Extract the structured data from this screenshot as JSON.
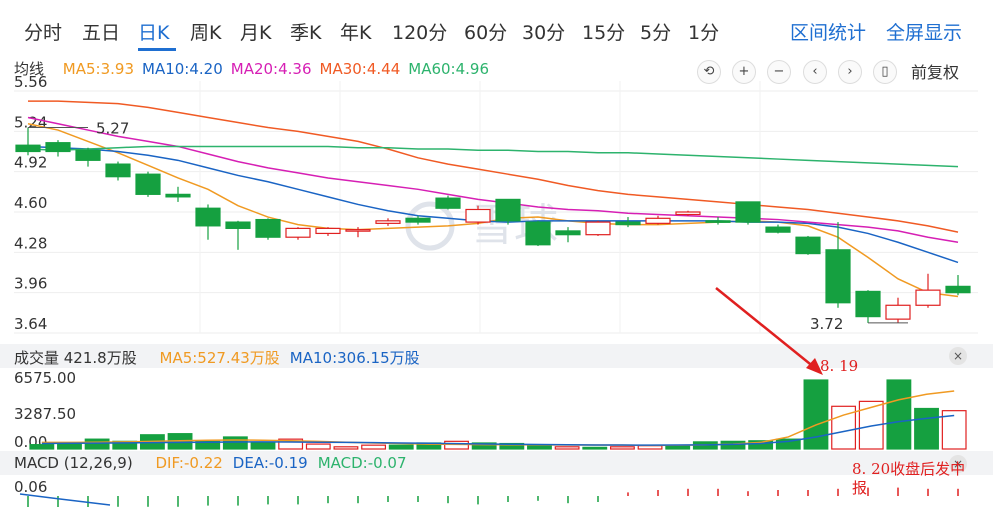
{
  "tabs": [
    "分时",
    "五日",
    "日K",
    "周K",
    "月K",
    "季K",
    "年K",
    "120分",
    "60分",
    "30分",
    "15分",
    "5分",
    "1分"
  ],
  "active_tab": "日K",
  "right_links": [
    "区间统计",
    "全屏显示"
  ],
  "ma_legend": {
    "label": "均线",
    "items": [
      {
        "text": "MA5:3.93",
        "color": "#f09a22"
      },
      {
        "text": "MA10:4.20",
        "color": "#1a64c4"
      },
      {
        "text": "MA20:4.36",
        "color": "#d61fb4"
      },
      {
        "text": "MA30:4.44",
        "color": "#f05a24"
      },
      {
        "text": "MA60:4.96",
        "color": "#2db36d"
      }
    ]
  },
  "tools": [
    "undo-icon",
    "zoom-in-icon",
    "zoom-out-icon",
    "prev-icon",
    "next-icon",
    "candle-icon"
  ],
  "adjust_label": "前复权",
  "watermark": "雪球",
  "price_axis": [
    "5.56",
    "5.24",
    "4.92",
    "4.60",
    "4.28",
    "3.96",
    "3.64"
  ],
  "price_annotations": {
    "high": "5.27",
    "low": "3.72"
  },
  "volume_panel": {
    "label": "成交量 421.8万股",
    "items": [
      {
        "text": "MA5:527.43万股",
        "color": "#f09a22"
      },
      {
        "text": "MA10:306.15万股",
        "color": "#1a64c4"
      }
    ],
    "axis": [
      "6575.00",
      "3287.50",
      "0.00"
    ]
  },
  "macd_panel": {
    "label": "MACD (12,26,9)",
    "items": [
      {
        "text": "DIF:-0.22",
        "color": "#f09a22"
      },
      {
        "text": "DEA:-0.19",
        "color": "#1a64c4"
      },
      {
        "text": "MACD:-0.07",
        "color": "#2db36d"
      }
    ],
    "axis": [
      "0.06"
    ]
  },
  "annotations": {
    "marker": "8. 19",
    "note_line1": "8. 20收盘后发中",
    "note_line2": "报"
  },
  "colors": {
    "up": "#e02020",
    "down": "#15a040",
    "accent": "#1f6fd1"
  },
  "chart_data": {
    "type": "candlestick",
    "ylim": [
      3.64,
      5.56
    ],
    "candles": [
      {
        "o": 5.13,
        "c": 5.08,
        "h": 5.27,
        "l": 5.05
      },
      {
        "o": 5.15,
        "c": 5.08,
        "h": 5.17,
        "l": 5.04
      },
      {
        "o": 5.09,
        "c": 5.01,
        "h": 5.11,
        "l": 4.96
      },
      {
        "o": 4.98,
        "c": 4.88,
        "h": 5.0,
        "l": 4.85
      },
      {
        "o": 4.9,
        "c": 4.74,
        "h": 4.92,
        "l": 4.72
      },
      {
        "o": 4.74,
        "c": 4.72,
        "h": 4.8,
        "l": 4.68
      },
      {
        "o": 4.63,
        "c": 4.49,
        "h": 4.66,
        "l": 4.38
      },
      {
        "o": 4.52,
        "c": 4.47,
        "h": 4.53,
        "l": 4.3
      },
      {
        "o": 4.54,
        "c": 4.4,
        "h": 4.55,
        "l": 4.38
      },
      {
        "o": 4.4,
        "c": 4.47,
        "h": 4.48,
        "l": 4.38
      },
      {
        "o": 4.43,
        "c": 4.47,
        "h": 4.48,
        "l": 4.41
      },
      {
        "o": 4.45,
        "c": 4.46,
        "h": 4.48,
        "l": 4.4
      },
      {
        "o": 4.51,
        "c": 4.53,
        "h": 4.55,
        "l": 4.49
      },
      {
        "o": 4.55,
        "c": 4.52,
        "h": 4.57,
        "l": 4.5
      },
      {
        "o": 4.71,
        "c": 4.63,
        "h": 4.73,
        "l": 4.62
      },
      {
        "o": 4.52,
        "c": 4.62,
        "h": 4.65,
        "l": 4.5
      },
      {
        "o": 4.7,
        "c": 4.53,
        "h": 4.7,
        "l": 4.5
      },
      {
        "o": 4.52,
        "c": 4.34,
        "h": 4.53,
        "l": 4.33
      },
      {
        "o": 4.45,
        "c": 4.42,
        "h": 4.48,
        "l": 4.36
      },
      {
        "o": 4.42,
        "c": 4.52,
        "h": 4.53,
        "l": 4.41
      },
      {
        "o": 4.52,
        "c": 4.5,
        "h": 4.56,
        "l": 4.48
      },
      {
        "o": 4.51,
        "c": 4.55,
        "h": 4.57,
        "l": 4.5
      },
      {
        "o": 4.58,
        "c": 4.6,
        "h": 4.61,
        "l": 4.57
      },
      {
        "o": 4.53,
        "c": 4.52,
        "h": 4.56,
        "l": 4.5
      },
      {
        "o": 4.68,
        "c": 4.52,
        "h": 4.68,
        "l": 4.5
      },
      {
        "o": 4.48,
        "c": 4.44,
        "h": 4.5,
        "l": 4.43
      },
      {
        "o": 4.4,
        "c": 4.27,
        "h": 4.41,
        "l": 4.26
      },
      {
        "o": 4.3,
        "c": 3.88,
        "h": 4.52,
        "l": 3.84
      },
      {
        "o": 3.97,
        "c": 3.77,
        "h": 3.98,
        "l": 3.72
      },
      {
        "o": 3.75,
        "c": 3.86,
        "h": 3.92,
        "l": 3.72
      },
      {
        "o": 3.86,
        "c": 3.98,
        "h": 4.11,
        "l": 3.84
      },
      {
        "o": 4.01,
        "c": 3.96,
        "h": 4.1,
        "l": 3.94
      }
    ],
    "ma_series": [
      {
        "name": "MA5",
        "values": [
          5.3,
          5.25,
          5.16,
          5.07,
          4.97,
          4.87,
          4.78,
          4.65,
          4.56,
          4.5,
          4.47,
          4.46,
          4.47,
          4.48,
          4.49,
          4.51,
          4.55,
          4.56,
          4.53,
          4.51,
          4.5,
          4.5,
          4.51,
          4.52,
          4.53,
          4.52,
          4.49,
          4.4,
          4.24,
          4.07,
          3.96,
          3.93
        ]
      },
      {
        "name": "MA10",
        "values": [
          5.12,
          5.11,
          5.1,
          5.08,
          5.05,
          5.01,
          4.95,
          4.89,
          4.84,
          4.78,
          4.72,
          4.66,
          4.61,
          4.57,
          4.55,
          4.53,
          4.52,
          4.53,
          4.53,
          4.53,
          4.53,
          4.53,
          4.53,
          4.53,
          4.52,
          4.52,
          4.51,
          4.48,
          4.43,
          4.36,
          4.28,
          4.2
        ]
      },
      {
        "name": "MA20",
        "values": [
          5.35,
          5.3,
          5.25,
          5.2,
          5.16,
          5.12,
          5.06,
          5.0,
          4.95,
          4.91,
          4.87,
          4.84,
          4.81,
          4.78,
          4.74,
          4.7,
          4.67,
          4.64,
          4.62,
          4.61,
          4.59,
          4.58,
          4.57,
          4.56,
          4.55,
          4.54,
          4.52,
          4.5,
          4.48,
          4.45,
          4.4,
          4.36
        ]
      },
      {
        "name": "MA30",
        "values": [
          5.48,
          5.48,
          5.47,
          5.46,
          5.43,
          5.39,
          5.35,
          5.31,
          5.27,
          5.24,
          5.2,
          5.16,
          5.1,
          5.03,
          4.98,
          4.94,
          4.9,
          4.86,
          4.81,
          4.77,
          4.74,
          4.72,
          4.7,
          4.68,
          4.66,
          4.64,
          4.62,
          4.59,
          4.56,
          4.53,
          4.49,
          4.44
        ]
      },
      {
        "name": "MA60",
        "values": [
          5.1,
          5.09,
          5.1,
          5.11,
          5.12,
          5.12,
          5.12,
          5.12,
          5.12,
          5.12,
          5.12,
          5.11,
          5.11,
          5.1,
          5.1,
          5.09,
          5.09,
          5.08,
          5.08,
          5.07,
          5.07,
          5.06,
          5.05,
          5.04,
          5.03,
          5.02,
          5.01,
          5.0,
          4.99,
          4.98,
          4.97,
          4.96
        ]
      }
    ],
    "volume": {
      "ylim": [
        0,
        6575
      ],
      "values": [
        400,
        500,
        900,
        700,
        1300,
        1400,
        700,
        1100,
        600,
        900,
        450,
        200,
        350,
        350,
        550,
        700,
        550,
        500,
        350,
        200,
        150,
        200,
        300,
        350,
        650,
        700,
        750,
        900,
        6300,
        3900,
        4350,
        6300,
        3700,
        3500
      ]
    },
    "volume_ma": [
      {
        "name": "MA5",
        "values": [
          600,
          600,
          620,
          650,
          700,
          750,
          800,
          820,
          800,
          750,
          700,
          620,
          550,
          500,
          450,
          420,
          400,
          390,
          380,
          370,
          360,
          350,
          330,
          340,
          380,
          450,
          600,
          1100,
          2200,
          3100,
          3800,
          4500,
          5000,
          5300
        ]
      },
      {
        "name": "MA10",
        "values": [
          500,
          520,
          540,
          560,
          580,
          600,
          620,
          640,
          650,
          640,
          620,
          600,
          580,
          550,
          520,
          490,
          460,
          430,
          410,
          390,
          370,
          360,
          350,
          360,
          380,
          420,
          500,
          700,
          1100,
          1600,
          2100,
          2500,
          2800,
          3060
        ]
      }
    ],
    "macd_bars": [
      -1.0,
      -1.0,
      -1.0,
      -0.9,
      -0.9,
      -0.9,
      -0.8,
      -0.8,
      -0.7,
      -0.7,
      -0.6,
      -0.6,
      -0.5,
      -0.5,
      -0.6,
      -0.7,
      -0.5,
      -0.4,
      -0.6,
      -0.5,
      0.3,
      0.5,
      0.6,
      0.6,
      0.4,
      0.5,
      0.5,
      0.6,
      0.7,
      0.7,
      0.6,
      0.6
    ]
  }
}
